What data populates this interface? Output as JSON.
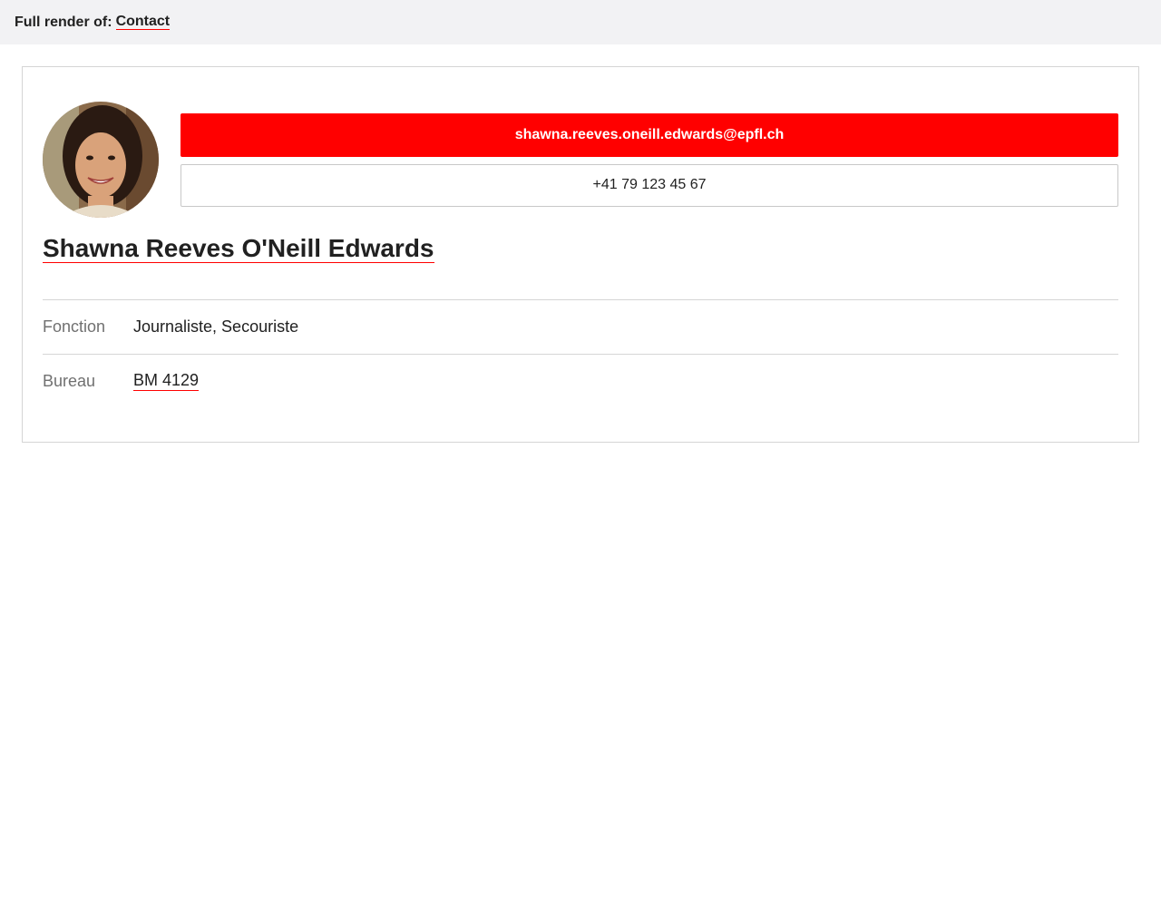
{
  "topbar": {
    "prefix": "Full render of:",
    "link": "Contact"
  },
  "contact": {
    "email": "shawna.reeves.oneill.edwards@epfl.ch",
    "phone": "+41 79 123 45 67",
    "name": "Shawna Reeves O'Neill Edwards",
    "details": [
      {
        "label": "Fonction",
        "value": "Journaliste, Secouriste"
      },
      {
        "label": "Bureau",
        "value": "BM 4129"
      }
    ]
  },
  "colors": {
    "accent": "#ff0000",
    "label": "#707070",
    "text": "#212121",
    "topbar_bg": "#f2f2f4",
    "border": "#d5d5d5"
  }
}
